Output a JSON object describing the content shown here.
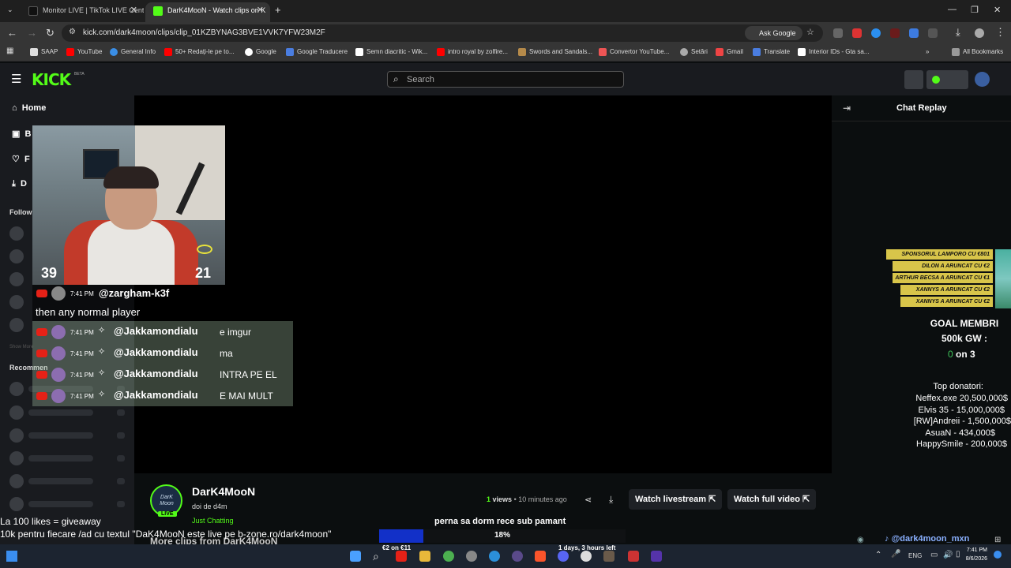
{
  "browser": {
    "tabs": [
      {
        "title": "Monitor LIVE | TikTok LIVE Cent",
        "active": false
      },
      {
        "title": "DarK4MooN - Watch clips on K",
        "active": true
      }
    ],
    "url": "kick.com/dark4moon/clips/clip_01KZBYNAG3BVE1VVK7YFW23M2F",
    "ask_google": "Ask Google",
    "bookmarks": [
      "SAAP",
      "YouTube",
      "General Info",
      "50+ Redați-le pe to...",
      "Google",
      "Google Traducere",
      "Semn diacritic - Wik...",
      "intro royal by zolfire...",
      "Swords and Sandals...",
      "Convertor YouTube...",
      "Setări",
      "Gmail",
      "Translate",
      "Interior IDs - Gta sa..."
    ],
    "all_bookmarks": "All Bookmarks"
  },
  "kick": {
    "logo": "KICK",
    "logo_badge": "BETA",
    "search_placeholder": "Search",
    "sidebar": {
      "home": "Home",
      "partial_items": [
        "B",
        "F",
        "D"
      ],
      "following_label": "Follow",
      "recommended_label": "Recommen",
      "faded_label": "Show More"
    },
    "chat_title": "Chat Replay",
    "channel": {
      "name": "DarK4MooN",
      "subtitle": "doi de d4m",
      "category": "Just Chatting",
      "live_badge": "LIVE",
      "avatar_text": "DarK Moon",
      "views_count": "1",
      "views_label": "views",
      "time_ago": "10 minutes ago",
      "watch_livestream": "Watch livestream",
      "watch_full_video": "Watch full video",
      "more_clips": "More clips from DarK4MooN"
    }
  },
  "overlay": {
    "cam_left_number": "39",
    "cam_right_number": "21",
    "first_chat": {
      "time": "7:41 PM",
      "user": "@zargham-k3f",
      "message": "then any normal player"
    },
    "chat_lines": [
      {
        "time": "7:41 PM",
        "user": "@Jakkamondialu",
        "message": "e imgur"
      },
      {
        "time": "7:41 PM",
        "user": "@Jakkamondialu",
        "message": "ma"
      },
      {
        "time": "7:41 PM",
        "user": "@Jakkamondialu",
        "message": "INTRA PE EL"
      },
      {
        "time": "7:41 PM",
        "user": "@Jakkamondialu",
        "message": "E MAI MULT"
      }
    ],
    "donations": [
      "SPONSORUL LAMPORO CU €801",
      "DILON A ARUNCAT CU €2",
      "ARTHUR BECSA A ARUNCAT CU €1",
      "XANNYS A ARUNCAT CU €2",
      "XANNYS A ARUNCAT CU €2"
    ],
    "goal_title": "GOAL MEMBRI",
    "goal_target": "500k GW :",
    "goal_progress_current": "0",
    "goal_progress_rest": "on 3",
    "top_title": "Top donatori:",
    "top_donors": [
      "Neffex.exe 20,500,000$",
      "Elvis 35 - 15,000,000$",
      "[RW]Andreii - 1,500,000$",
      "AsuaN - 434,000$",
      "HappySmile - 200,000$"
    ],
    "bottom_line1": "La 100 likes = giveaway",
    "bottom_line2": "10k pentru fiecare /ad cu textul \"DaK4MooN este live pe b-zone.ro/dark4moon\"",
    "song": "perna sa dorm rece sub pamant",
    "song_percent": "18%",
    "tiktok_handle": "@dark4moon_mxn",
    "donation_goal_mini": "€2 on €11",
    "timer": "1 days, 3 hours left"
  },
  "taskbar": {
    "lang": "ENG",
    "time": "7:41 PM",
    "date": "8/6/2026"
  },
  "colors": {
    "kick_green": "#53fc18",
    "donation_gold": "#d8c54a",
    "taskbar": "#1c2430"
  }
}
